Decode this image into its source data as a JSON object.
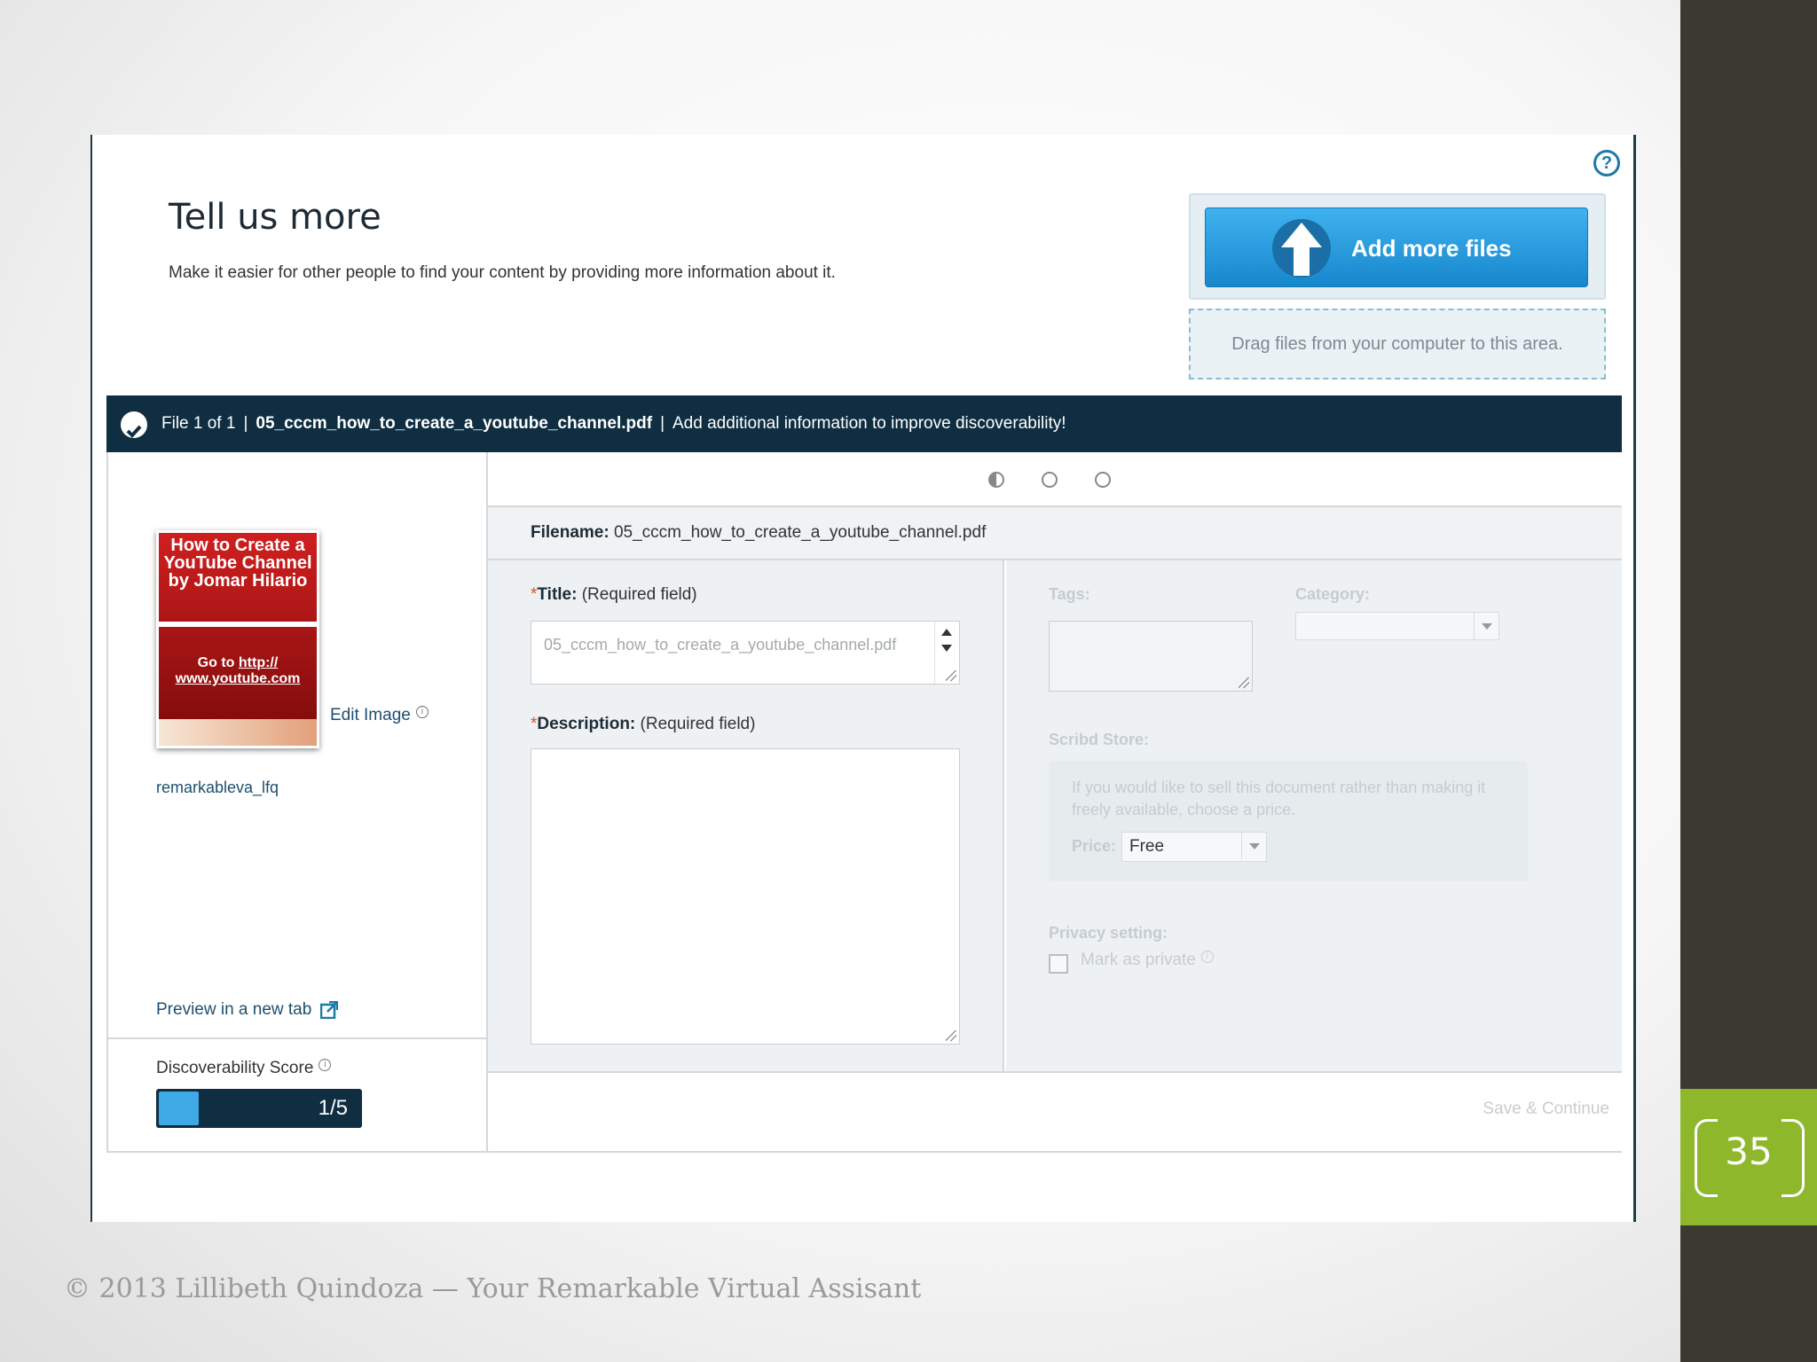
{
  "header": {
    "title": "Tell us more",
    "subtitle": "Make it easier for other people to find your content by providing more information about it."
  },
  "upload": {
    "add_button_label": "Add more files",
    "drop_zone_text": "Drag files from your computer to this area."
  },
  "file_bar": {
    "counter": "File 1 of 1",
    "separator": "|",
    "filename": "05_cccm_how_to_create_a_youtube_channel.pdf",
    "message": "Add additional information to improve discoverability!"
  },
  "thumbnail": {
    "title_lines": "How to Create a YouTube Channel by Jomar Hilario",
    "link_prefix": "Go to ",
    "link_url": "http:// www.youtube.com"
  },
  "left_panel": {
    "edit_image": "Edit Image",
    "username": "remarkableva_lfq",
    "preview_link": "Preview in a new tab",
    "score_label": "Discoverability Score",
    "score_value": "1/5",
    "score_fraction": 0.2
  },
  "steps": {
    "total": 3,
    "current": 1
  },
  "form": {
    "filename_label": "Filename:",
    "filename_value": "05_cccm_how_to_create_a_youtube_channel.pdf",
    "title_label": "Title:",
    "title_hint": "(Required field)",
    "title_value": "05_cccm_how_to_create_a_youtube_channel.pdf",
    "description_label": "Description:",
    "description_hint": "(Required field)",
    "required_mark": "*"
  },
  "meta": {
    "tags_label": "Tags:",
    "category_label": "Category:",
    "store_label": "Scribd Store:",
    "store_text": "If you would like to sell this document rather than making it freely available, choose a price.",
    "price_label": "Price:",
    "price_value": "Free",
    "privacy_label": "Privacy setting:",
    "private_label": "Mark as private"
  },
  "actions": {
    "save_continue": "Save & Continue"
  },
  "slide": {
    "page_number": "35",
    "footer": "© 2013 Lillibeth Quindoza  — Your Remarkable Virtual Assisant"
  },
  "colors": {
    "dark_navy": "#0f2e42",
    "button_blue": "#2196dc",
    "accent_green": "#8fb72b",
    "side_strip": "#3b3a30"
  }
}
